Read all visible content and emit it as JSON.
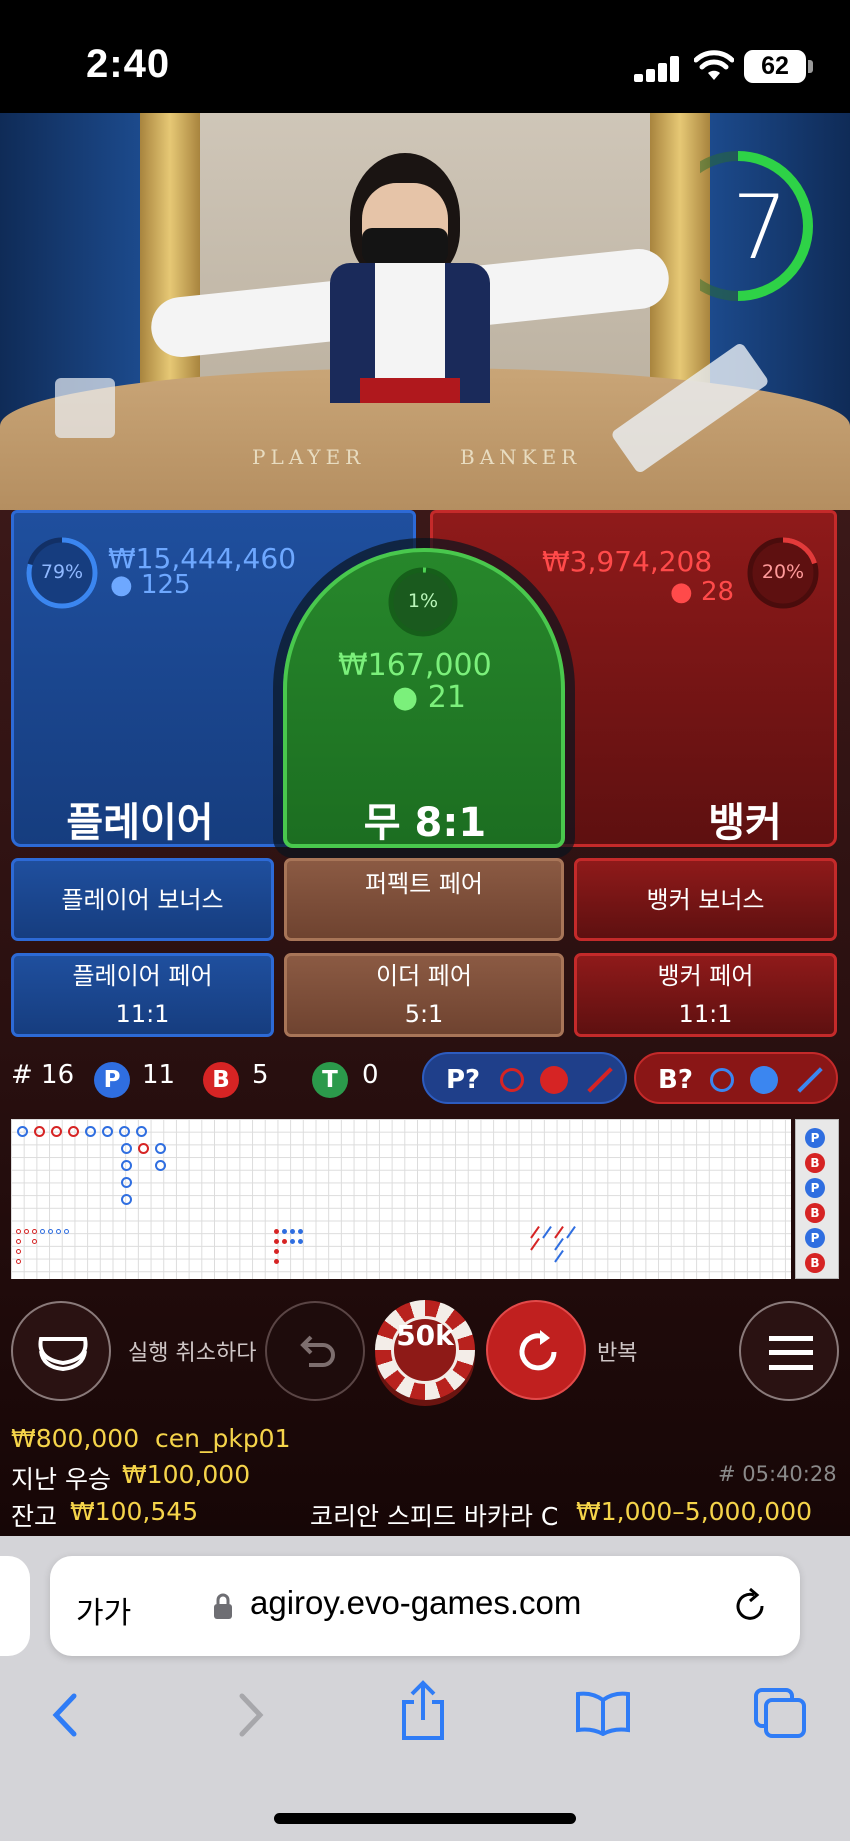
{
  "status_bar": {
    "time": "2:40",
    "battery": "62"
  },
  "video": {
    "timer": "7",
    "table_label_player": "PLAYER",
    "table_label_banker": "BANKER"
  },
  "bets": {
    "player": {
      "label": "플레이어",
      "percent": "79%",
      "amount": "₩15,444,460",
      "players": "125"
    },
    "tie": {
      "label": "무 8:1",
      "percent": "1%",
      "amount": "₩167,000",
      "players": "21"
    },
    "banker": {
      "label": "뱅커",
      "percent": "20%",
      "amount": "₩3,974,208",
      "players": "28"
    }
  },
  "side_bets": {
    "player_bonus": "플레이어 보너스",
    "perfect_pair": "퍼펙트 페어",
    "banker_bonus": "뱅커 보너스",
    "player_pair": {
      "label": "플레이어 페어",
      "odds": "11:1"
    },
    "either_pair": {
      "label": "이더 페어",
      "odds": "5:1"
    },
    "banker_pair": {
      "label": "뱅커 페어",
      "odds": "11:1"
    }
  },
  "stats": {
    "round": "# 16",
    "player_letter": "P",
    "player_count": "11",
    "banker_letter": "B",
    "banker_count": "5",
    "tie_letter": "T",
    "tie_count": "0",
    "player_predict": "P?",
    "banker_predict": "B?"
  },
  "roadmap_side": [
    "P",
    "B",
    "P",
    "B",
    "P",
    "B"
  ],
  "controls": {
    "undo_label": "실행 취소하다",
    "chip_value": "50k",
    "repeat_label": "반복"
  },
  "footer": {
    "bet_amount": "₩800,000",
    "username": "cen_pkp01",
    "last_win_label": "지난 우승",
    "last_win_value": "₩100,000",
    "game_id": "# 05:40:28",
    "balance_label": "잔고",
    "balance_value": "₩100,545",
    "table_name": "코리안 스피드 바카라 C",
    "limits": "₩1,000–5,000,000"
  },
  "browser": {
    "text_size": "가가",
    "url": "agiroy.evo-games.com"
  },
  "colors": {
    "player": "#1f4f9e",
    "banker": "#8f1a1a",
    "tie": "#27872b",
    "gold": "#f5d44a"
  }
}
